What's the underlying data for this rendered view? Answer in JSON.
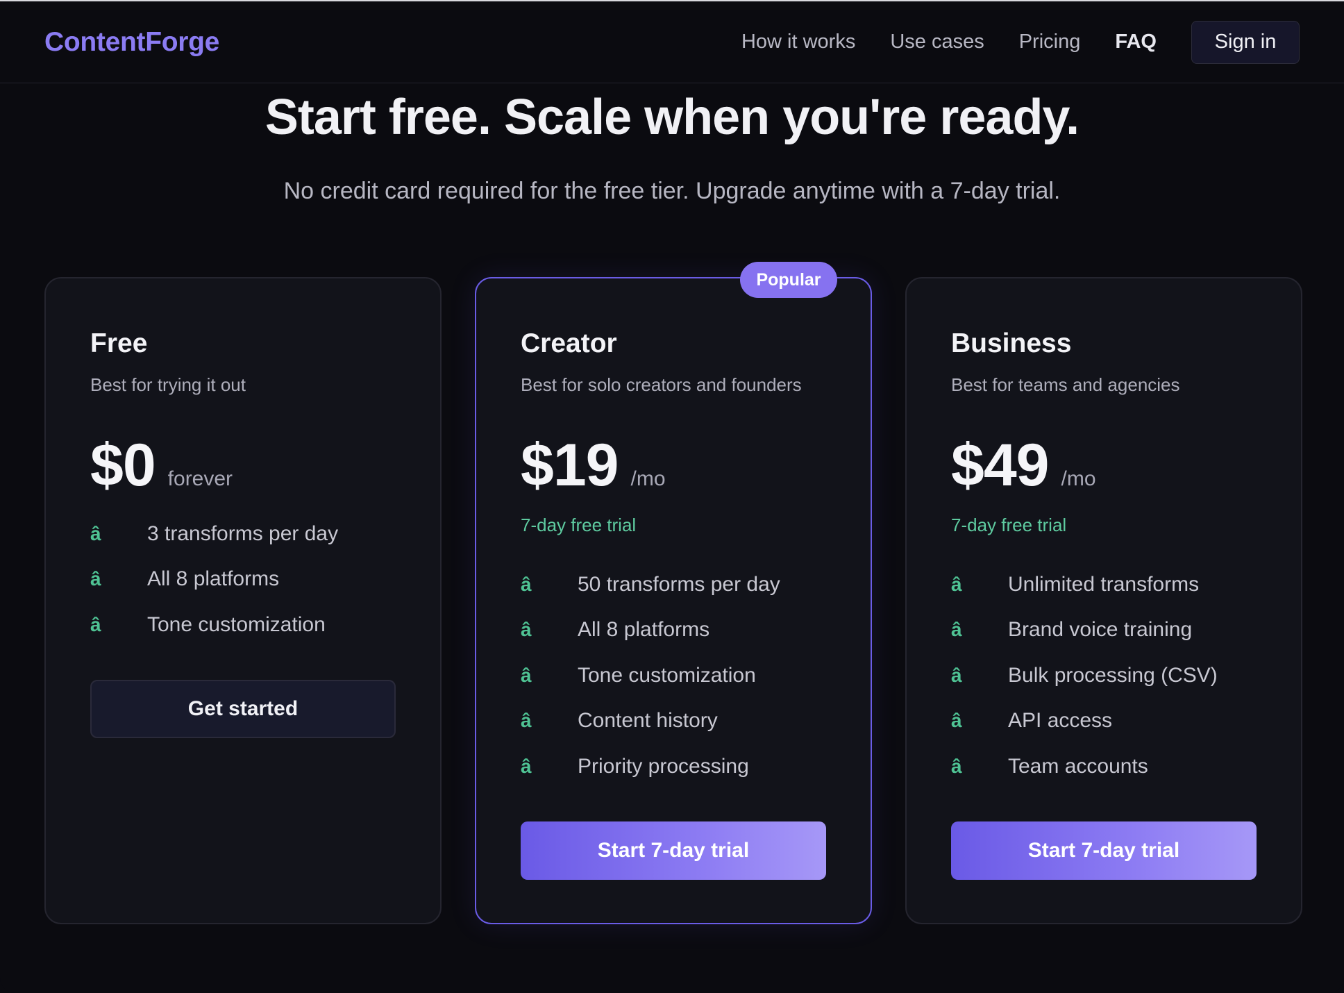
{
  "header": {
    "logo": "ContentForge",
    "nav": [
      "How it works",
      "Use cases",
      "Pricing",
      "FAQ"
    ],
    "active_nav": "FAQ",
    "signin_label": "Sign in"
  },
  "hero": {
    "title": "Start free. Scale when you're ready.",
    "subtitle": "No credit card required for the free tier. Upgrade anytime with a 7-day trial."
  },
  "plans": [
    {
      "name": "Free",
      "description": "Best for trying it out",
      "price": "$0",
      "period": "forever",
      "trial": "",
      "features": [
        "3 transforms per day",
        "All 8 platforms",
        "Tone customization"
      ],
      "cta": "Get started"
    },
    {
      "name": "Creator",
      "badge": "Popular",
      "description": "Best for solo creators and founders",
      "price": "$19",
      "period": "/mo",
      "trial": "7-day free trial",
      "features": [
        "50 transforms per day",
        "All 8 platforms",
        "Tone customization",
        "Content history",
        "Priority processing"
      ],
      "cta": "Start 7-day trial"
    },
    {
      "name": "Business",
      "description": "Best for teams and agencies",
      "price": "$49",
      "period": "/mo",
      "trial": "7-day free trial",
      "features": [
        "Unlimited transforms",
        "Brand voice training",
        "Bulk processing (CSV)",
        "API access",
        "Team accounts"
      ],
      "cta": "Start 7-day trial"
    }
  ],
  "feature_marker": "â",
  "colors": {
    "background": "#0b0b10",
    "card": "#12131a",
    "accent": "#8b7cf3",
    "check": "#4fc394",
    "trial": "#5ecba0"
  }
}
